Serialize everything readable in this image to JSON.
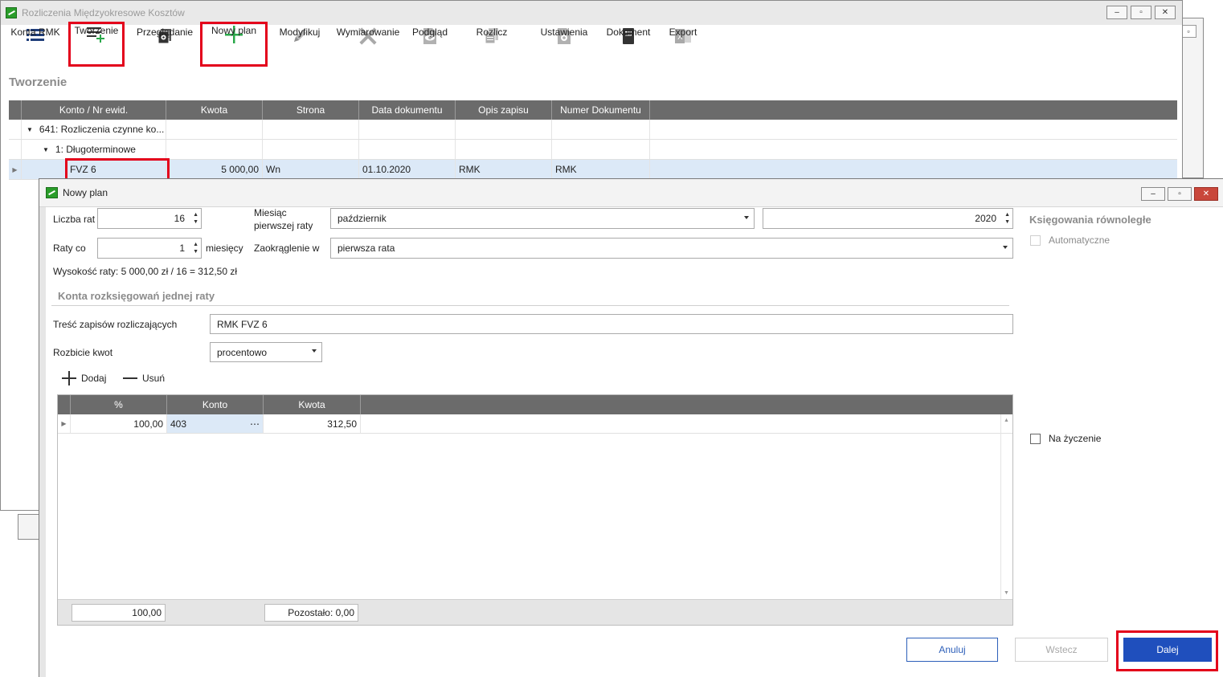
{
  "main_window": {
    "title": "Rozliczenia Międzyokresowe Kosztów",
    "controls": [
      "‒",
      "▫",
      "✕"
    ]
  },
  "toolbar": {
    "items": [
      {
        "label": "Konta RMK",
        "icon": "list-icon"
      },
      {
        "label": "Tworzenie",
        "icon": "list-add-icon"
      },
      {
        "label": "Przeglądanie",
        "icon": "browse-icon"
      },
      {
        "label": "Nowy plan",
        "icon": "plus-icon"
      },
      {
        "label": "Modyfikuj",
        "icon": "pencil-icon"
      },
      {
        "label": "Wymiarowanie",
        "icon": "tools-icon"
      },
      {
        "label": "Podgląd",
        "icon": "eye-icon"
      },
      {
        "label": "Rozlicz",
        "icon": "documents-icon"
      },
      {
        "label": "Ustawienia",
        "icon": "settings-icon"
      },
      {
        "label": "Dokument",
        "icon": "document-icon"
      },
      {
        "label": "Export",
        "icon": "excel-icon"
      }
    ]
  },
  "section_title": "Tworzenie",
  "grid": {
    "columns": [
      "Konto / Nr ewid.",
      "Kwota",
      "Strona",
      "Data dokumentu",
      "Opis zapisu",
      "Numer Dokumentu"
    ],
    "rows": [
      {
        "konto": "641: Rozliczenia czynne ko...",
        "kwota": "",
        "strona": "",
        "data": "",
        "opis": "",
        "numer": ""
      },
      {
        "konto": "1: Długoterminowe",
        "kwota": "",
        "strona": "",
        "data": "",
        "opis": "",
        "numer": ""
      },
      {
        "konto": "FVZ 6",
        "kwota": "5 000,00",
        "strona": "Wn",
        "data": "01.10.2020",
        "opis": "RMK",
        "numer": "RMK"
      }
    ]
  },
  "dialog": {
    "title": "Nowy plan",
    "controls": [
      "‒",
      "▫",
      "✕"
    ],
    "liczba_rat_label": "Liczba rat",
    "liczba_rat_value": "16",
    "miesiac_label_1": "Miesiąc",
    "miesiac_label_2": "pierwszej raty",
    "miesiac_value": "październik",
    "rok_value": "2020",
    "raty_co_label": "Raty co",
    "raty_co_value": "1",
    "miesiecy_label": "miesięcy",
    "zaokraglenie_label": "Zaokrąglenie w",
    "zaokraglenie_value": "pierwsza rata",
    "wysokosc_text": "Wysokość raty: 5 000,00 zł / 16 = 312,50 zł",
    "konta_heading": "Konta rozksięgowań jednej raty",
    "tresc_label": "Treść zapisów rozliczających",
    "tresc_value": "RMK FVZ 6",
    "rozbicie_label": "Rozbicie kwot",
    "rozbicie_value": "procentowo",
    "add_label": "Dodaj",
    "remove_label": "Usuń",
    "inner_grid": {
      "columns": [
        "%",
        "Konto",
        "Kwota"
      ],
      "rows": [
        {
          "procent": "100,00",
          "konto": "403",
          "kwota": "312,50"
        }
      ],
      "footer_sum": "100,00",
      "footer_remaining": "Pozostało: 0,00"
    },
    "side_title": "Księgowania równoległe",
    "automatyczne_label": "Automatyczne",
    "na_zyczenie_label": "Na życzenie",
    "buttons": {
      "cancel": "Anuluj",
      "back": "Wstecz",
      "next": "Dalej"
    }
  },
  "colors": {
    "highlight": "#e3001b",
    "grid_header": "#6b6b6b",
    "primary_button": "#1f4fbd",
    "selected_row": "#dce9f7"
  }
}
